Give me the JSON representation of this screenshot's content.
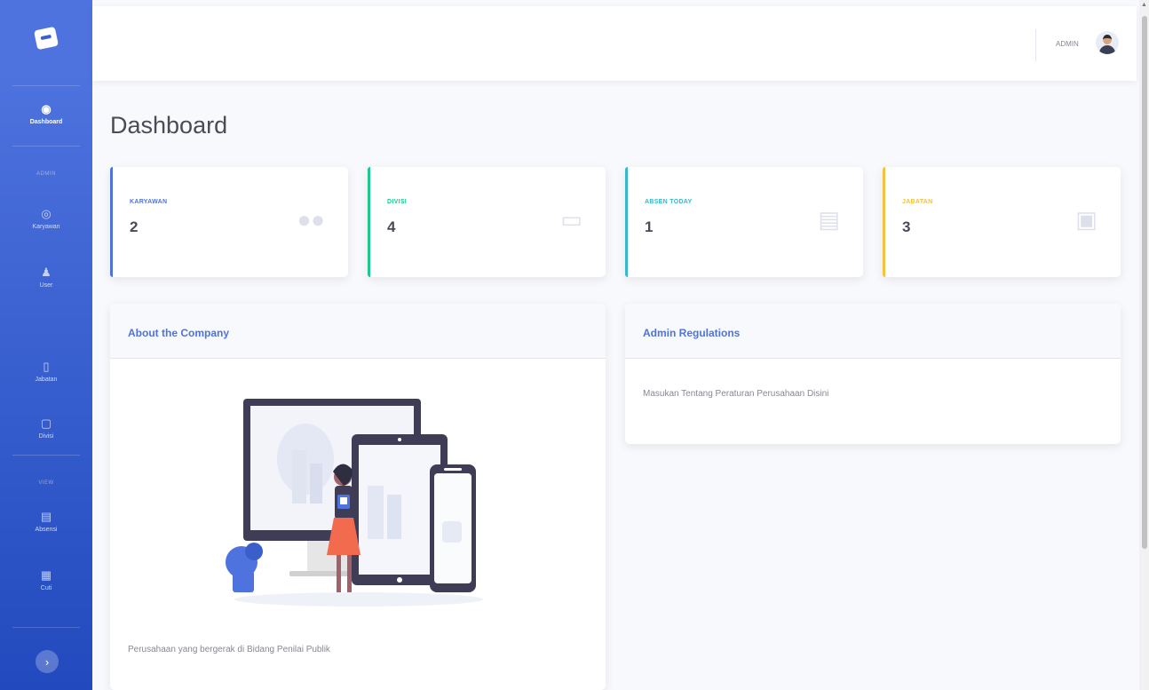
{
  "sidebar": {
    "items": [
      {
        "label": "Dashboard",
        "icon": "tachometer-icon"
      },
      {
        "label": "Karyawan",
        "icon": "users-icon"
      },
      {
        "label": "User",
        "icon": "user-icon"
      },
      {
        "label": "Jabatan",
        "icon": "briefcase-icon"
      },
      {
        "label": "Divisi",
        "icon": "desktop-icon"
      },
      {
        "label": "Absensi",
        "icon": "clipboard-icon"
      },
      {
        "label": "Cuti",
        "icon": "calendar-icon"
      }
    ],
    "headings": [
      "ADMIN",
      "VIEW"
    ]
  },
  "topbar": {
    "user_name": "ADMIN"
  },
  "page": {
    "title": "Dashboard"
  },
  "cards": [
    {
      "label": "KARYAWAN",
      "value": "2",
      "color": "#4e73df",
      "icon": "users-icon"
    },
    {
      "label": "DIVISI",
      "value": "4",
      "color": "#1cc88a",
      "icon": "desktop-icon"
    },
    {
      "label": "ABSEN TODAY",
      "value": "1",
      "color": "#36b9cc",
      "icon": "clipboard-icon"
    },
    {
      "label": "JABATAN",
      "value": "3",
      "color": "#f6c23e",
      "icon": "id-card-icon"
    }
  ],
  "about": {
    "title": "About the Company",
    "text": "Perusahaan yang bergerak di Bidang Penilai Publik"
  },
  "regulations": {
    "title": "Admin Regulations",
    "text": "Masukan Tentang Peraturan Perusahaan Disini"
  },
  "colors": {
    "primary": "#4e73df",
    "success": "#1cc88a",
    "info": "#36b9cc",
    "warning": "#f6c23e"
  }
}
